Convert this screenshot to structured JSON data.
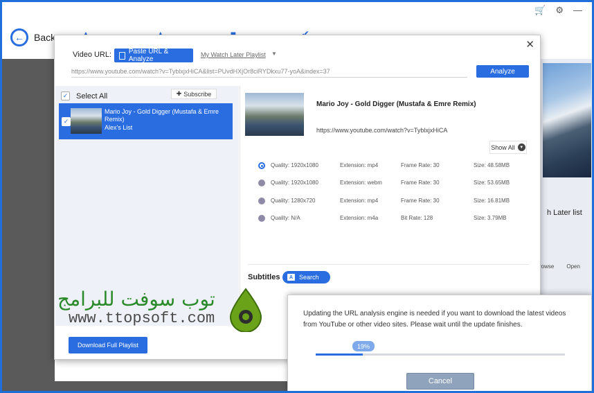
{
  "background": {
    "back_label": "Back",
    "right_list_label": "h Later list",
    "right_link_browse": "rowse",
    "right_link_open": "Open"
  },
  "dialog": {
    "video_url_label": "Video URL:",
    "paste_button": "Paste URL & Analyze",
    "watch_later_link": "My Watch Later Playlist",
    "url_value": "https://www.youtube.com/watch?v=TyblxjxHiCA&list=PUvdHXjOr8ciRYDkxu77-yoA&index=37",
    "analyze_button": "Analyze",
    "select_all": "Select All",
    "subscribe_button": "Subscribe",
    "playlist": [
      {
        "title": "Mario Joy - Gold Digger (Mustafa & Emre Remix)",
        "list": "Alex's List",
        "checked": true
      }
    ],
    "download_full_playlist": "Download Full Playlist",
    "video": {
      "title": "Mario Joy - Gold Digger (Mustafa & Emre Remix)",
      "url": "https://www.youtube.com/watch?v=TyblxjxHiCA"
    },
    "show_all": "Show All",
    "qualities": [
      {
        "quality": "Quality: 1920x1080",
        "ext": "Extension: mp4",
        "rate": "Frame Rate: 30",
        "size": "Size: 48.58MB",
        "selected": true
      },
      {
        "quality": "Quality: 1920x1080",
        "ext": "Extension: webm",
        "rate": "Frame Rate: 30",
        "size": "Size: 53.65MB",
        "selected": false
      },
      {
        "quality": "Quality: 1280x720",
        "ext": "Extension: mp4",
        "rate": "Frame Rate: 30",
        "size": "Size: 16.81MB",
        "selected": false
      },
      {
        "quality": "Quality: N/A",
        "ext": "Extension: m4a",
        "rate": "Bit Rate: 128",
        "size": "Size: 3.79MB",
        "selected": false
      }
    ],
    "subtitles_label": "Subtitles",
    "subtitles_search": "Search"
  },
  "watermark": {
    "arabic": "توب سوفت للبرامج",
    "url": "www.ttopsoft.com"
  },
  "update_dialog": {
    "message": "Updating the URL analysis engine is needed if you want to download the latest videos from YouTube or other video sites. Please wait until the update finishes.",
    "progress_label": "19%",
    "progress": 0.19,
    "cancel_button": "Cancel"
  },
  "colors": {
    "accent": "#2a6de0",
    "watermark_green": "#2a8a2a"
  }
}
